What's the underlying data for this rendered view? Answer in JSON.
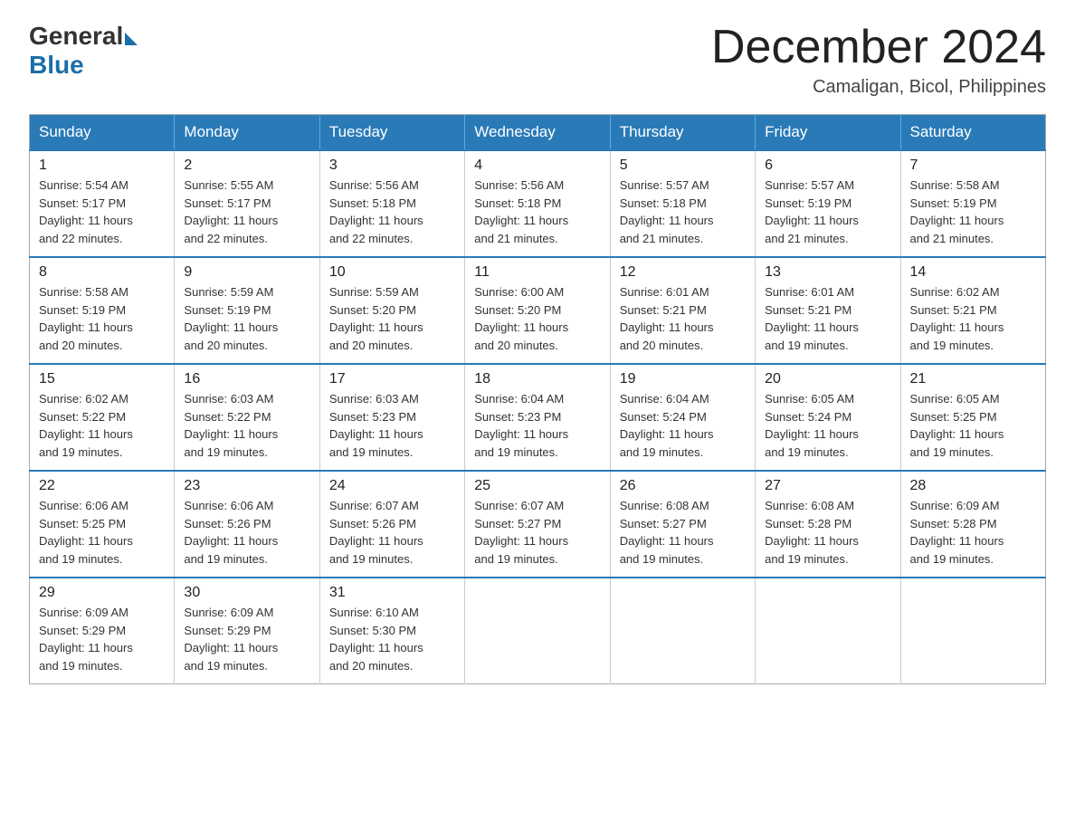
{
  "logo": {
    "general": "General",
    "blue": "Blue"
  },
  "title": "December 2024",
  "subtitle": "Camaligan, Bicol, Philippines",
  "days_of_week": [
    "Sunday",
    "Monday",
    "Tuesday",
    "Wednesday",
    "Thursday",
    "Friday",
    "Saturday"
  ],
  "weeks": [
    [
      {
        "day": "1",
        "sunrise": "5:54 AM",
        "sunset": "5:17 PM",
        "daylight": "11 hours and 22 minutes."
      },
      {
        "day": "2",
        "sunrise": "5:55 AM",
        "sunset": "5:17 PM",
        "daylight": "11 hours and 22 minutes."
      },
      {
        "day": "3",
        "sunrise": "5:56 AM",
        "sunset": "5:18 PM",
        "daylight": "11 hours and 22 minutes."
      },
      {
        "day": "4",
        "sunrise": "5:56 AM",
        "sunset": "5:18 PM",
        "daylight": "11 hours and 21 minutes."
      },
      {
        "day": "5",
        "sunrise": "5:57 AM",
        "sunset": "5:18 PM",
        "daylight": "11 hours and 21 minutes."
      },
      {
        "day": "6",
        "sunrise": "5:57 AM",
        "sunset": "5:19 PM",
        "daylight": "11 hours and 21 minutes."
      },
      {
        "day": "7",
        "sunrise": "5:58 AM",
        "sunset": "5:19 PM",
        "daylight": "11 hours and 21 minutes."
      }
    ],
    [
      {
        "day": "8",
        "sunrise": "5:58 AM",
        "sunset": "5:19 PM",
        "daylight": "11 hours and 20 minutes."
      },
      {
        "day": "9",
        "sunrise": "5:59 AM",
        "sunset": "5:19 PM",
        "daylight": "11 hours and 20 minutes."
      },
      {
        "day": "10",
        "sunrise": "5:59 AM",
        "sunset": "5:20 PM",
        "daylight": "11 hours and 20 minutes."
      },
      {
        "day": "11",
        "sunrise": "6:00 AM",
        "sunset": "5:20 PM",
        "daylight": "11 hours and 20 minutes."
      },
      {
        "day": "12",
        "sunrise": "6:01 AM",
        "sunset": "5:21 PM",
        "daylight": "11 hours and 20 minutes."
      },
      {
        "day": "13",
        "sunrise": "6:01 AM",
        "sunset": "5:21 PM",
        "daylight": "11 hours and 19 minutes."
      },
      {
        "day": "14",
        "sunrise": "6:02 AM",
        "sunset": "5:21 PM",
        "daylight": "11 hours and 19 minutes."
      }
    ],
    [
      {
        "day": "15",
        "sunrise": "6:02 AM",
        "sunset": "5:22 PM",
        "daylight": "11 hours and 19 minutes."
      },
      {
        "day": "16",
        "sunrise": "6:03 AM",
        "sunset": "5:22 PM",
        "daylight": "11 hours and 19 minutes."
      },
      {
        "day": "17",
        "sunrise": "6:03 AM",
        "sunset": "5:23 PM",
        "daylight": "11 hours and 19 minutes."
      },
      {
        "day": "18",
        "sunrise": "6:04 AM",
        "sunset": "5:23 PM",
        "daylight": "11 hours and 19 minutes."
      },
      {
        "day": "19",
        "sunrise": "6:04 AM",
        "sunset": "5:24 PM",
        "daylight": "11 hours and 19 minutes."
      },
      {
        "day": "20",
        "sunrise": "6:05 AM",
        "sunset": "5:24 PM",
        "daylight": "11 hours and 19 minutes."
      },
      {
        "day": "21",
        "sunrise": "6:05 AM",
        "sunset": "5:25 PM",
        "daylight": "11 hours and 19 minutes."
      }
    ],
    [
      {
        "day": "22",
        "sunrise": "6:06 AM",
        "sunset": "5:25 PM",
        "daylight": "11 hours and 19 minutes."
      },
      {
        "day": "23",
        "sunrise": "6:06 AM",
        "sunset": "5:26 PM",
        "daylight": "11 hours and 19 minutes."
      },
      {
        "day": "24",
        "sunrise": "6:07 AM",
        "sunset": "5:26 PM",
        "daylight": "11 hours and 19 minutes."
      },
      {
        "day": "25",
        "sunrise": "6:07 AM",
        "sunset": "5:27 PM",
        "daylight": "11 hours and 19 minutes."
      },
      {
        "day": "26",
        "sunrise": "6:08 AM",
        "sunset": "5:27 PM",
        "daylight": "11 hours and 19 minutes."
      },
      {
        "day": "27",
        "sunrise": "6:08 AM",
        "sunset": "5:28 PM",
        "daylight": "11 hours and 19 minutes."
      },
      {
        "day": "28",
        "sunrise": "6:09 AM",
        "sunset": "5:28 PM",
        "daylight": "11 hours and 19 minutes."
      }
    ],
    [
      {
        "day": "29",
        "sunrise": "6:09 AM",
        "sunset": "5:29 PM",
        "daylight": "11 hours and 19 minutes."
      },
      {
        "day": "30",
        "sunrise": "6:09 AM",
        "sunset": "5:29 PM",
        "daylight": "11 hours and 19 minutes."
      },
      {
        "day": "31",
        "sunrise": "6:10 AM",
        "sunset": "5:30 PM",
        "daylight": "11 hours and 20 minutes."
      },
      null,
      null,
      null,
      null
    ]
  ],
  "labels": {
    "sunrise": "Sunrise:",
    "sunset": "Sunset:",
    "daylight": "Daylight:"
  }
}
